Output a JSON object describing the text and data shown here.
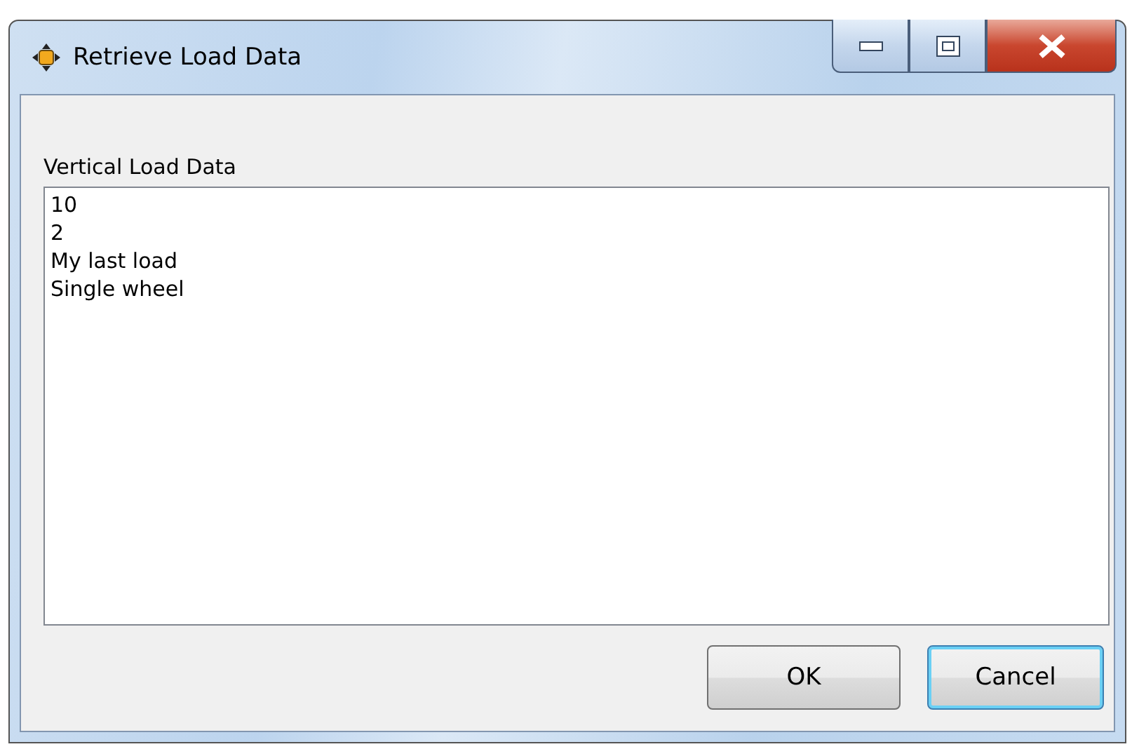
{
  "window": {
    "title": "Retrieve Load Data"
  },
  "field_label": "Vertical Load Data",
  "text_area": {
    "lines": [
      "10",
      "2",
      "My last load",
      "Single wheel"
    ]
  },
  "buttons": [
    {
      "label": "OK",
      "focused": false
    },
    {
      "label": "Cancel",
      "focused": true
    }
  ]
}
